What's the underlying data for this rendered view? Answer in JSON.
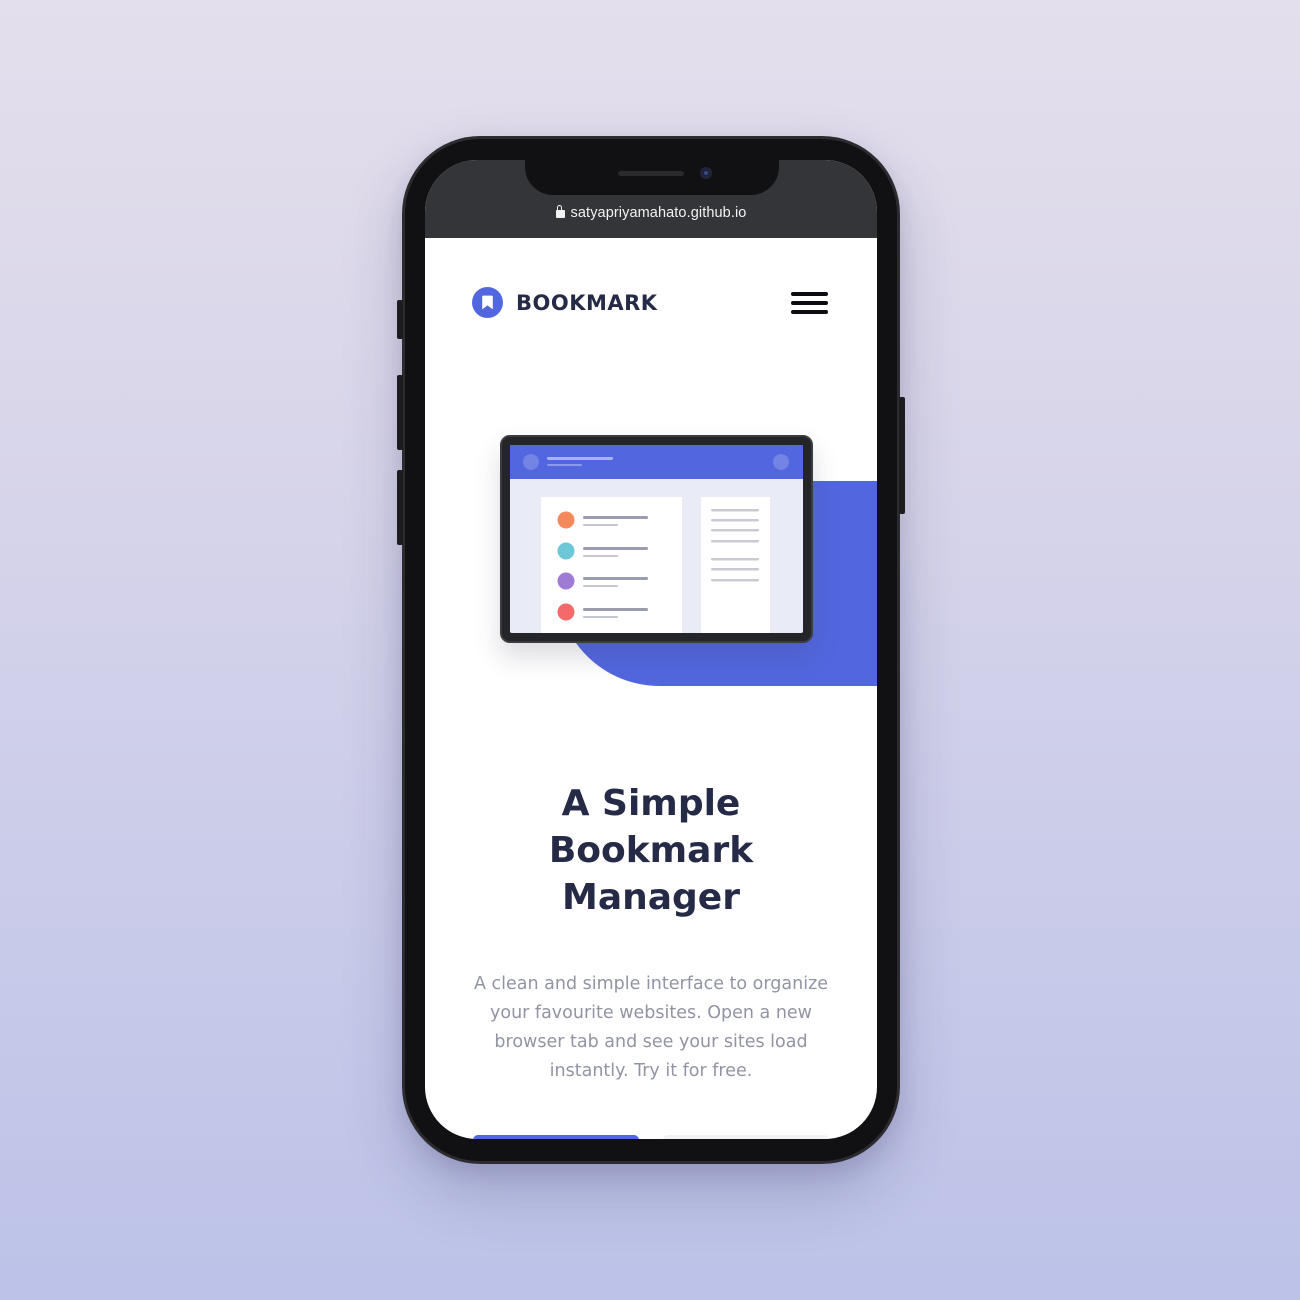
{
  "browser": {
    "url": "satyapriyamahato.github.io"
  },
  "header": {
    "brand": "BOOKMARK",
    "menu_icon": "hamburger-menu-icon"
  },
  "hero": {
    "illustration": "tablet-bookmark-illustration",
    "headline_lines": [
      "A Simple",
      "Bookmark",
      "Manager"
    ],
    "description": "A clean and simple interface to organize your favourite websites. Open a new browser tab and see your sites load instantly. Try it for free."
  },
  "colors": {
    "accent": "#5267df",
    "heading": "#252b46",
    "body_text": "#9194a2",
    "browser_bar": "#343539",
    "dot_orange": "#f4895c",
    "dot_teal": "#6ec7d7",
    "dot_purple": "#a07bd6",
    "dot_red": "#f26b6b"
  }
}
